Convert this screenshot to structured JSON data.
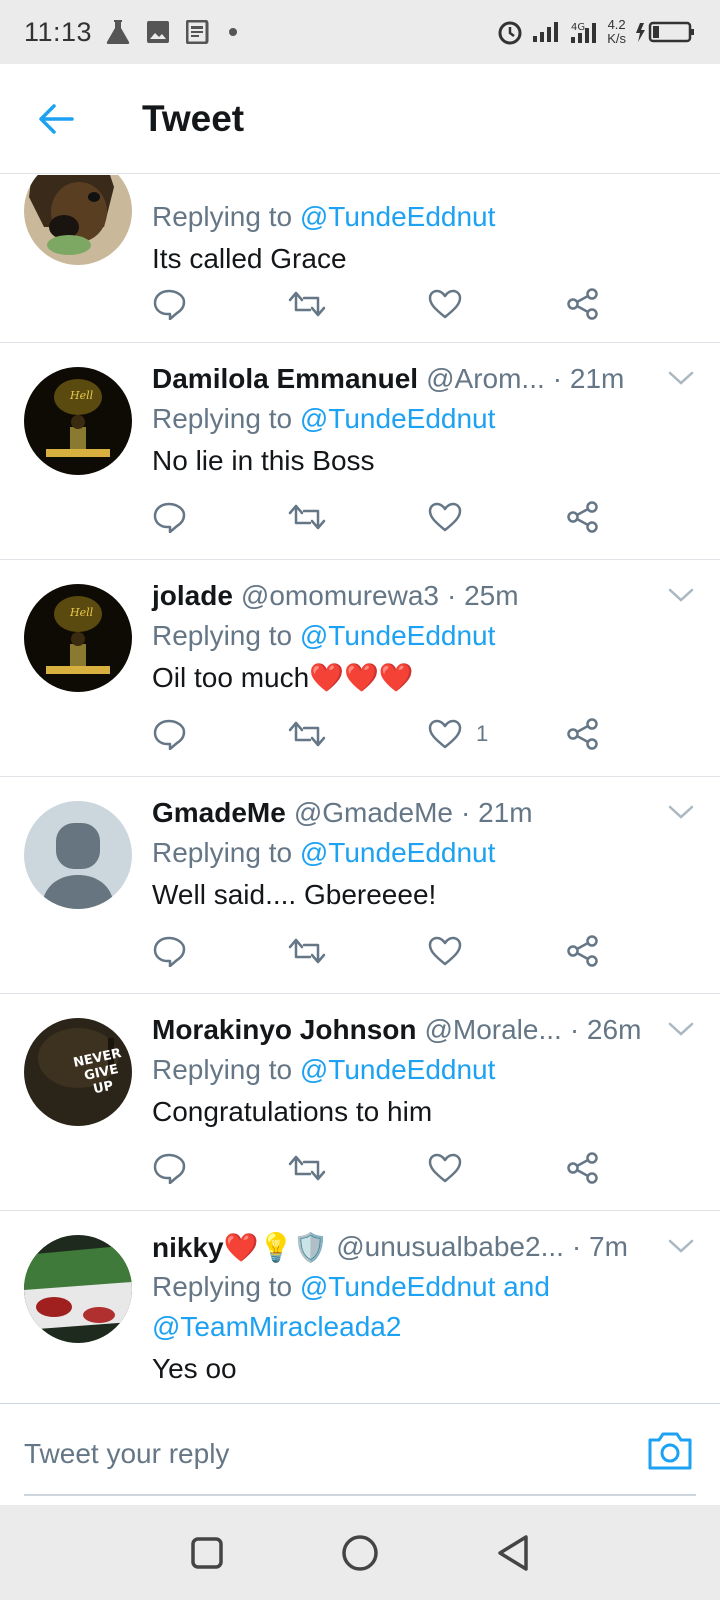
{
  "status_bar": {
    "time": "11:13",
    "network_speed_value": "4.2",
    "network_speed_unit": "K/s"
  },
  "header": {
    "title": "Tweet"
  },
  "tweets": [
    {
      "name": "",
      "handle": "",
      "time": "",
      "replying_prefix": "Replying to",
      "replying_to": "@TundeEddnut",
      "text": "Its called Grace",
      "like_count": ""
    },
    {
      "name": "Damilola Emmanuel",
      "handle": "@Arom...",
      "time": "· 21m",
      "replying_prefix": "Replying to",
      "replying_to": "@TundeEddnut",
      "text": "No lie in this Boss",
      "like_count": ""
    },
    {
      "name": "jolade",
      "handle": "@omomurewa3",
      "time": "· 25m",
      "replying_prefix": "Replying to",
      "replying_to": "@TundeEddnut",
      "text": "Oil too much❤️❤️❤️",
      "like_count": "1"
    },
    {
      "name": "GmadeMe",
      "handle": "@GmadeMe",
      "time": "· 21m",
      "replying_prefix": "Replying to",
      "replying_to": "@TundeEddnut",
      "text": "Well said.... Gbereeee!",
      "like_count": ""
    },
    {
      "name": "Morakinyo Johnson",
      "handle": "@Morale...",
      "time": "· 26m",
      "replying_prefix": "Replying to",
      "replying_to": "@TundeEddnut",
      "text": "Congratulations to him",
      "like_count": ""
    },
    {
      "name": "nikky❤️💡🛡️",
      "handle": "@unusualbabe2...",
      "time": "· 7m",
      "replying_prefix": "Replying to",
      "replying_to": "@TundeEddnut and",
      "replying_to_2": "@TeamMiracleada2",
      "text": "Yes oo"
    }
  ],
  "avatar_5_text": "NEVER GIVE UP",
  "reply_bar": {
    "placeholder": "Tweet your reply"
  },
  "colors": {
    "accent": "#1da1f2",
    "secondary_text": "#657786",
    "primary_text": "#14171a",
    "divider": "#dfe3e8",
    "heart": "#e0245e"
  },
  "icons": [
    "back-arrow-icon",
    "reply-icon",
    "retweet-icon",
    "like-icon",
    "share-icon",
    "chevron-down-icon",
    "camera-icon",
    "alarm-icon",
    "signal-icon",
    "battery-icon"
  ]
}
